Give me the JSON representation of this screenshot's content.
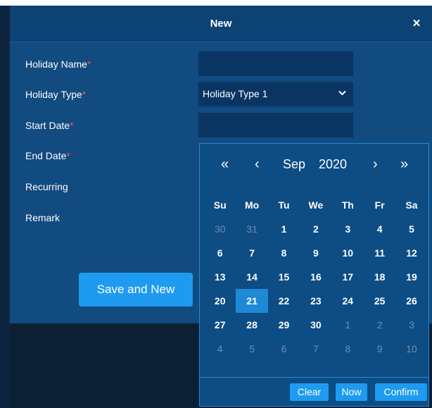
{
  "dialog": {
    "title": "New",
    "close_glyph": "×"
  },
  "form": {
    "labels": {
      "holiday_name": "Holiday Name",
      "holiday_type": "Holiday Type",
      "start_date": "Start Date",
      "end_date": "End Date",
      "recurring": "Recurring",
      "remark": "Remark"
    },
    "required_mark": "*",
    "holiday_type_value": "Holiday Type 1",
    "save_and_new_label": "Save and New"
  },
  "calendar": {
    "prev_year": "«",
    "prev_month": "‹",
    "month": "Sep",
    "year": "2020",
    "next_month": "›",
    "next_year": "»",
    "weekdays": [
      "Su",
      "Mo",
      "Tu",
      "We",
      "Th",
      "Fr",
      "Sa"
    ],
    "weeks": [
      [
        {
          "d": "30",
          "dim": true
        },
        {
          "d": "31",
          "dim": true
        },
        {
          "d": "1"
        },
        {
          "d": "2"
        },
        {
          "d": "3"
        },
        {
          "d": "4"
        },
        {
          "d": "5"
        }
      ],
      [
        {
          "d": "6"
        },
        {
          "d": "7"
        },
        {
          "d": "8"
        },
        {
          "d": "9"
        },
        {
          "d": "10"
        },
        {
          "d": "11"
        },
        {
          "d": "12"
        }
      ],
      [
        {
          "d": "13"
        },
        {
          "d": "14"
        },
        {
          "d": "15"
        },
        {
          "d": "16"
        },
        {
          "d": "17"
        },
        {
          "d": "18"
        },
        {
          "d": "19"
        }
      ],
      [
        {
          "d": "20"
        },
        {
          "d": "21",
          "selected": true
        },
        {
          "d": "22"
        },
        {
          "d": "23"
        },
        {
          "d": "24"
        },
        {
          "d": "25"
        },
        {
          "d": "26"
        }
      ],
      [
        {
          "d": "27"
        },
        {
          "d": "28"
        },
        {
          "d": "29"
        },
        {
          "d": "30"
        },
        {
          "d": "1",
          "dim": true
        },
        {
          "d": "2",
          "dim": true
        },
        {
          "d": "3",
          "dim": true
        }
      ],
      [
        {
          "d": "4",
          "dim": true
        },
        {
          "d": "5",
          "dim": true
        },
        {
          "d": "6",
          "dim": true
        },
        {
          "d": "7",
          "dim": true
        },
        {
          "d": "8",
          "dim": true
        },
        {
          "d": "9",
          "dim": true
        },
        {
          "d": "10",
          "dim": true
        }
      ]
    ],
    "buttons": {
      "clear": "Clear",
      "now": "Now",
      "confirm": "Confirm"
    }
  },
  "colors": {
    "accent": "#1e9bf0",
    "required": "#ff4d4f",
    "dialog_bg": "#114b80",
    "input_bg": "#0a3563",
    "selected_day": "#1e8ad6"
  }
}
